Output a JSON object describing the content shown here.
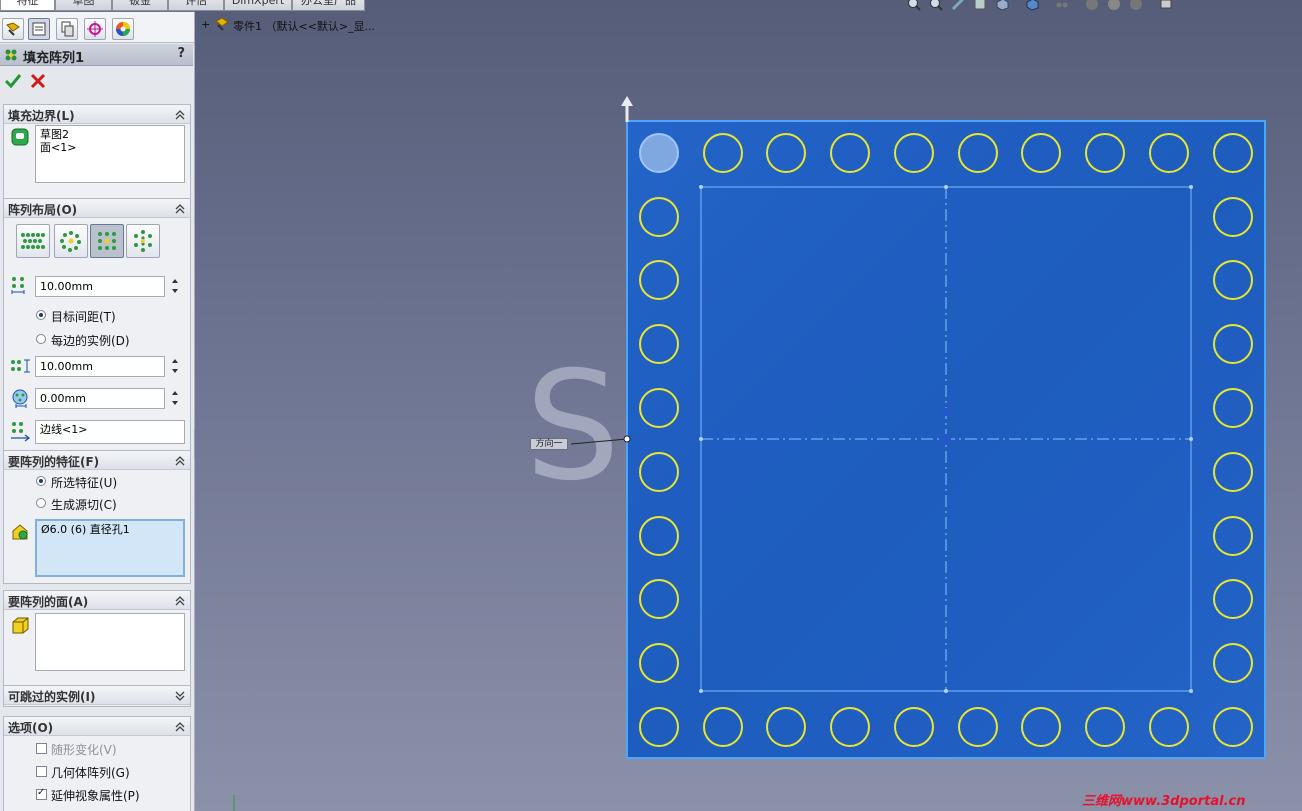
{
  "top_tabs": [
    "特征",
    "草图",
    "钣金",
    "评估",
    "DimXpert",
    "办公室产品"
  ],
  "feature": {
    "title": "填充阵列1",
    "help": "?"
  },
  "groups": {
    "boundary": {
      "title": "填充边界(L)",
      "items": [
        "草图2",
        "面<1>"
      ]
    },
    "layout": {
      "title": "阵列布局(O)",
      "spacing": "10.00mm",
      "radio_target": "目标间距(T)",
      "radio_per_side": "每边的实例(D)",
      "margin": "10.00mm",
      "angle": "0.00mm",
      "direction": "边线<1>"
    },
    "features": {
      "title": "要阵列的特征(F)",
      "radio_selected": "所选特征(U)",
      "radio_cut": "生成源切(C)",
      "list_item": "Ø6.0 (6) 直径孔1"
    },
    "faces": {
      "title": "要阵列的面(A)"
    },
    "skip": {
      "title": "可跳过的实例(I)"
    },
    "options": {
      "title": "选项(O)",
      "vary": "随形变化(V)",
      "geometry": "几何体阵列(G)",
      "propagate": "延伸视象属性(P)",
      "states": {
        "vary": false,
        "geometry": false,
        "propagate": true
      }
    }
  },
  "viewport": {
    "tree_label": "零件1 （默认<<默认>_显...",
    "direction_label": "方向一",
    "watermark": "SO",
    "footer_mark": "三维网www.3dportal.cn"
  },
  "colors": {
    "plate": "#1f5fc0",
    "circle": "#e8e631",
    "edge_highlight": "#4aa6ff"
  }
}
